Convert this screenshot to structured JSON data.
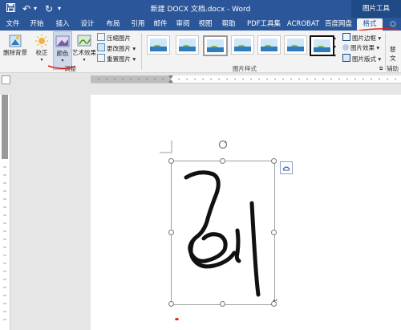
{
  "titlebar": {
    "title": "新建 DOCX 文档.docx - Word",
    "context_group": "图片工具",
    "save_icon": "save-icon",
    "undo_icon": "undo-icon",
    "redo_icon": "redo-icon",
    "customize_icon": "dropdown-icon"
  },
  "tabs": [
    {
      "label": "文件"
    },
    {
      "label": "开始"
    },
    {
      "label": "插入"
    },
    {
      "label": "设计"
    },
    {
      "label": "布局"
    },
    {
      "label": "引用"
    },
    {
      "label": "邮件"
    },
    {
      "label": "审阅"
    },
    {
      "label": "视图"
    },
    {
      "label": "帮助"
    },
    {
      "label": "PDF工具集"
    },
    {
      "label": "ACROBAT"
    },
    {
      "label": "百度网盘"
    },
    {
      "label": "格式",
      "active": true
    }
  ],
  "ribbon": {
    "remove_bg": "删除背景",
    "corrections": "校正",
    "color": "颜色",
    "artistic": "艺术效果",
    "compress": "压缩图片",
    "change": "更改图片",
    "reset": "重置图片",
    "adjust_group": "调整",
    "styles_group": "图片样式",
    "border": "图片边框",
    "effects": "图片效果",
    "layout": "图片版式",
    "alt_text_1": "替",
    "alt_text_2": "文",
    "accessibility_group": "辅助"
  },
  "colors": {
    "accent": "#2b579a",
    "ribbon_bg": "#f3f3f3",
    "annotation_red": "#e0201a"
  }
}
